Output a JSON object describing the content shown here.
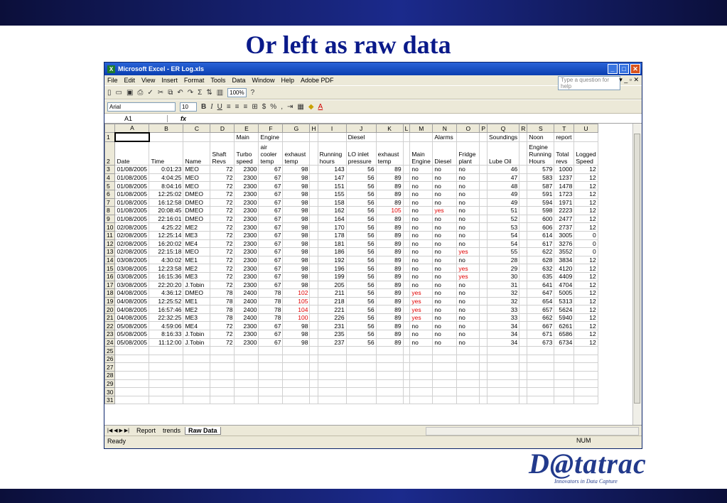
{
  "slide": {
    "title": "Or left as raw data"
  },
  "logo": {
    "name": "D@tatrac",
    "tagline": "Innovators in Data Capture"
  },
  "window": {
    "title": "Microsoft Excel - ER Log.xls"
  },
  "menu": [
    "File",
    "Edit",
    "View",
    "Insert",
    "Format",
    "Tools",
    "Data",
    "Window",
    "Help",
    "Adobe PDF"
  ],
  "help_placeholder": "Type a question for help",
  "toolbar": {
    "zoom": "100%",
    "font": "Arial",
    "size": "10"
  },
  "namebox": "A1",
  "columns": [
    "A",
    "B",
    "C",
    "D",
    "E",
    "F",
    "G",
    "H",
    "I",
    "J",
    "K",
    "L",
    "M",
    "N",
    "O",
    "P",
    "Q",
    "R",
    "S",
    "T",
    "U"
  ],
  "header_row1": [
    "",
    "",
    "",
    "",
    "Main",
    "Engine",
    "",
    "",
    "",
    "Diesel",
    "",
    "",
    "",
    "Alarms",
    "",
    "",
    "Soundings",
    "",
    "Noon",
    "report",
    ""
  ],
  "header_row2": [
    [
      "Date"
    ],
    [
      "Time"
    ],
    [
      "Name"
    ],
    [
      "Shaft",
      "Revs"
    ],
    [
      "Turbo",
      "speed"
    ],
    [
      "air",
      "cooler",
      "temp"
    ],
    [
      "exhaust",
      "temp"
    ],
    [
      ""
    ],
    [
      "Running",
      "hours"
    ],
    [
      "LO inlet",
      "pressure"
    ],
    [
      "exhaust",
      "temp"
    ],
    [
      ""
    ],
    [
      "Main",
      "Engine"
    ],
    [
      "Diesel"
    ],
    [
      "Fridge",
      "plant"
    ],
    [
      ""
    ],
    [
      "Lube Oil"
    ],
    [
      ""
    ],
    [
      "Engine",
      "Running",
      "Hours"
    ],
    [
      "Total",
      "revs"
    ],
    [
      "Logged",
      "Speed"
    ]
  ],
  "rows": [
    [
      "01/08/2005",
      "0:01:23",
      "MEO",
      "72",
      "2300",
      "67",
      "98",
      "",
      "143",
      "56",
      "89",
      "",
      "no",
      "no",
      "no",
      "",
      "46",
      "",
      "579",
      "1000",
      "12"
    ],
    [
      "01/08/2005",
      "4:04:25",
      "MEO",
      "72",
      "2300",
      "67",
      "98",
      "",
      "147",
      "56",
      "89",
      "",
      "no",
      "no",
      "no",
      "",
      "47",
      "",
      "583",
      "1237",
      "12"
    ],
    [
      "01/08/2005",
      "8:04:16",
      "MEO",
      "72",
      "2300",
      "67",
      "98",
      "",
      "151",
      "56",
      "89",
      "",
      "no",
      "no",
      "no",
      "",
      "48",
      "",
      "587",
      "1478",
      "12"
    ],
    [
      "01/08/2005",
      "12:25:02",
      "DMEO",
      "72",
      "2300",
      "67",
      "98",
      "",
      "155",
      "56",
      "89",
      "",
      "no",
      "no",
      "no",
      "",
      "49",
      "",
      "591",
      "1723",
      "12"
    ],
    [
      "01/08/2005",
      "16:12:58",
      "DMEO",
      "72",
      "2300",
      "67",
      "98",
      "",
      "158",
      "56",
      "89",
      "",
      "no",
      "no",
      "no",
      "",
      "49",
      "",
      "594",
      "1971",
      "12"
    ],
    [
      "01/08/2005",
      "20:08:45",
      "DMEO",
      "72",
      "2300",
      "67",
      "98",
      "",
      "162",
      "56",
      "105",
      "",
      "no",
      "yes",
      "no",
      "",
      "51",
      "",
      "598",
      "2223",
      "12"
    ],
    [
      "01/08/2005",
      "22:16:01",
      "DMEO",
      "72",
      "2300",
      "67",
      "98",
      "",
      "164",
      "56",
      "89",
      "",
      "no",
      "no",
      "no",
      "",
      "52",
      "",
      "600",
      "2477",
      "12"
    ],
    [
      "02/08/2005",
      "4:25:22",
      "ME2",
      "72",
      "2300",
      "67",
      "98",
      "",
      "170",
      "56",
      "89",
      "",
      "no",
      "no",
      "no",
      "",
      "53",
      "",
      "606",
      "2737",
      "12"
    ],
    [
      "02/08/2005",
      "12:25:14",
      "ME3",
      "72",
      "2300",
      "67",
      "98",
      "",
      "178",
      "56",
      "89",
      "",
      "no",
      "no",
      "no",
      "",
      "54",
      "",
      "614",
      "3005",
      "0"
    ],
    [
      "02/08/2005",
      "16:20:02",
      "ME4",
      "72",
      "2300",
      "67",
      "98",
      "",
      "181",
      "56",
      "89",
      "",
      "no",
      "no",
      "no",
      "",
      "54",
      "",
      "617",
      "3276",
      "0"
    ],
    [
      "02/08/2005",
      "22:15:18",
      "MEO",
      "72",
      "2300",
      "67",
      "98",
      "",
      "186",
      "56",
      "89",
      "",
      "no",
      "no",
      "yes",
      "",
      "55",
      "",
      "622",
      "3552",
      "0"
    ],
    [
      "03/08/2005",
      "4:30:02",
      "ME1",
      "72",
      "2300",
      "67",
      "98",
      "",
      "192",
      "56",
      "89",
      "",
      "no",
      "no",
      "no",
      "",
      "28",
      "",
      "628",
      "3834",
      "12"
    ],
    [
      "03/08/2005",
      "12:23:58",
      "ME2",
      "72",
      "2300",
      "67",
      "98",
      "",
      "196",
      "56",
      "89",
      "",
      "no",
      "no",
      "yes",
      "",
      "29",
      "",
      "632",
      "4120",
      "12"
    ],
    [
      "03/08/2005",
      "16:15:36",
      "ME3",
      "72",
      "2300",
      "67",
      "98",
      "",
      "199",
      "56",
      "89",
      "",
      "no",
      "no",
      "yes",
      "",
      "30",
      "",
      "635",
      "4409",
      "12"
    ],
    [
      "03/08/2005",
      "22:20:20",
      "J.Tobin",
      "72",
      "2300",
      "67",
      "98",
      "",
      "205",
      "56",
      "89",
      "",
      "no",
      "no",
      "no",
      "",
      "31",
      "",
      "641",
      "4704",
      "12"
    ],
    [
      "04/08/2005",
      "4:36:12",
      "DMEO",
      "78",
      "2400",
      "78",
      "102",
      "",
      "211",
      "56",
      "89",
      "",
      "yes",
      "no",
      "no",
      "",
      "32",
      "",
      "647",
      "5005",
      "12"
    ],
    [
      "04/08/2005",
      "12:25:52",
      "ME1",
      "78",
      "2400",
      "78",
      "105",
      "",
      "218",
      "56",
      "89",
      "",
      "yes",
      "no",
      "no",
      "",
      "32",
      "",
      "654",
      "5313",
      "12"
    ],
    [
      "04/08/2005",
      "16:57:46",
      "ME2",
      "78",
      "2400",
      "78",
      "104",
      "",
      "221",
      "56",
      "89",
      "",
      "yes",
      "no",
      "no",
      "",
      "33",
      "",
      "657",
      "5624",
      "12"
    ],
    [
      "04/08/2005",
      "22:32:25",
      "ME3",
      "78",
      "2400",
      "78",
      "100",
      "",
      "226",
      "56",
      "89",
      "",
      "yes",
      "no",
      "no",
      "",
      "33",
      "",
      "662",
      "5940",
      "12"
    ],
    [
      "05/08/2005",
      "4:59:06",
      "ME4",
      "72",
      "2300",
      "67",
      "98",
      "",
      "231",
      "56",
      "89",
      "",
      "no",
      "no",
      "no",
      "",
      "34",
      "",
      "667",
      "6261",
      "12"
    ],
    [
      "05/08/2005",
      "8:16:33",
      "J.Tobin",
      "72",
      "2300",
      "67",
      "98",
      "",
      "235",
      "56",
      "89",
      "",
      "no",
      "no",
      "no",
      "",
      "34",
      "",
      "671",
      "6586",
      "12"
    ],
    [
      "05/08/2005",
      "11:12:00",
      "J.Tobin",
      "72",
      "2300",
      "67",
      "98",
      "",
      "237",
      "56",
      "89",
      "",
      "no",
      "no",
      "no",
      "",
      "34",
      "",
      "673",
      "6734",
      "12"
    ]
  ],
  "red_cells": [
    [
      5,
      10
    ],
    [
      5,
      13
    ],
    [
      10,
      14
    ],
    [
      12,
      14
    ],
    [
      13,
      14
    ],
    [
      15,
      6
    ],
    [
      15,
      12
    ],
    [
      16,
      6
    ],
    [
      16,
      12
    ],
    [
      17,
      6
    ],
    [
      17,
      12
    ],
    [
      18,
      6
    ],
    [
      18,
      12
    ]
  ],
  "empty_rows": [
    "25",
    "26",
    "27",
    "28",
    "29",
    "30",
    "31"
  ],
  "sheet_tabs": [
    "Report",
    "trends",
    "Raw Data"
  ],
  "active_tab": "Raw Data",
  "status": {
    "left": "Ready",
    "right": "NUM"
  }
}
